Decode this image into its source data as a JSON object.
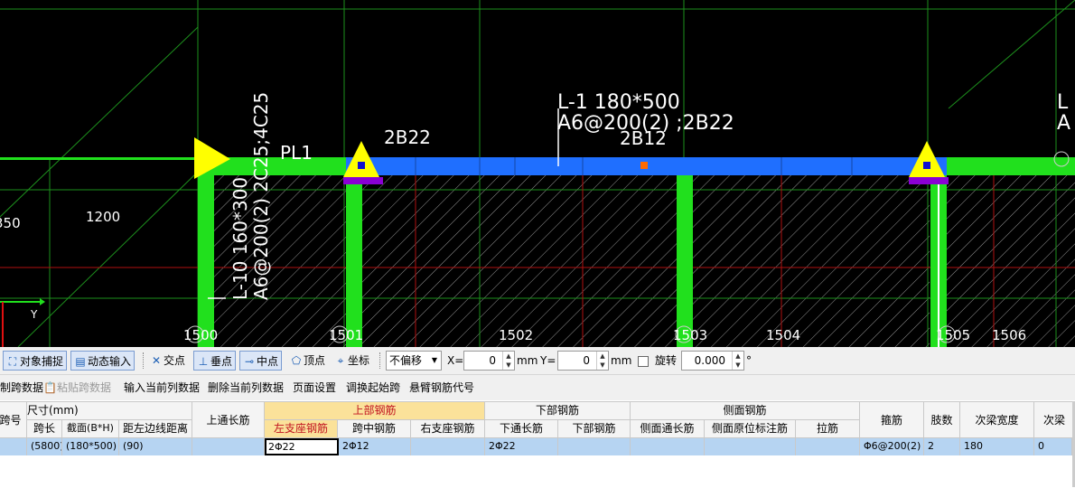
{
  "cad": {
    "beam_main_name": "L-1 180*500",
    "beam_main_rebar": "A6@200(2) ;2B22",
    "beam_main_mid": "2B12",
    "beam_top_left": "2B22",
    "beam_left_code": "PL1",
    "beam_vertical_name": "L-10 160*300",
    "beam_vertical_rebar": "A6@200(2) 2C25;4C25",
    "dim_1200": "1200",
    "dim_850": "350",
    "axis_y": "Y",
    "right_edge_name": "L",
    "right_edge_rebar": "A",
    "grid_labels": [
      "1500",
      "1501",
      "1502",
      "1503",
      "1504",
      "1505",
      "1506"
    ],
    "colors": {
      "background": "#000000",
      "beam_blue": "#1f6fff",
      "column_green": "#21e01d",
      "grid_red": "#b01010",
      "grid_green": "#1d8f1d",
      "support_yellow": "#ffff00",
      "support_purple": "#8a00d4"
    }
  },
  "snapbar": {
    "object_snap": "对象捕捉",
    "dynamic_input": "动态输入",
    "intersection": "交点",
    "perpendicular": "垂点",
    "midpoint": "中点",
    "vertex": "顶点",
    "coordinate": "坐标",
    "offset_mode": "不偏移",
    "x_label": "X=",
    "x_value": "0",
    "y_label": "Y=",
    "y_value": "0",
    "unit": "mm",
    "rotate_label": "旋转",
    "rotate_value": "0.000",
    "degree": "°",
    "icons": [
      "object-snap-icon",
      "dynamic-input-icon",
      "intersection-icon",
      "perpendicular-icon",
      "midpoint-icon",
      "vertex-icon",
      "coordinate-icon"
    ]
  },
  "toolbar": {
    "copy_span": "制跨数据",
    "paste_span": "粘贴跨数据",
    "input_current": "输入当前列数据",
    "delete_current": "删除当前列数据",
    "page_setup": "页面设置",
    "adjust_start": "调换起始跨",
    "cantilever_code": "悬臂钢筋代号"
  },
  "table": {
    "headers": {
      "span_no": "跨号",
      "size": "尺寸(mm)",
      "span_length": "跨长",
      "section": "截面(B*H)",
      "dist_left": "距左边线距离",
      "top_through": "上通长筋",
      "top_rebar": "上部钢筋",
      "left_support": "左支座钢筋",
      "mid_span": "跨中钢筋",
      "right_support": "右支座钢筋",
      "bottom_rebar": "下部钢筋",
      "bottom_through": "下通长筋",
      "bottom_bars": "下部钢筋",
      "side_rebar": "侧面钢筋",
      "side_through": "侧面通长筋",
      "side_in_situ": "侧面原位标注筋",
      "tie_bar": "拉筋",
      "stirrup": "箍筋",
      "legs": "肢数",
      "sec_beam_width": "次梁宽度",
      "sec_beam_extra": "次梁"
    },
    "row": {
      "span_length": "(5800)",
      "section": "(180*500)",
      "dist_left": "(90)",
      "top_through": "",
      "left_support": "2Φ22",
      "mid_span": "2Φ12",
      "right_support": "",
      "bottom_through": "2Φ22",
      "bottom_bars": "",
      "side_through": "",
      "side_in_situ": "",
      "tie_bar": "",
      "stirrup": "Φ6@200(2)",
      "legs": "2",
      "sec_beam_width": "180",
      "sec_beam_extra": "0"
    }
  }
}
